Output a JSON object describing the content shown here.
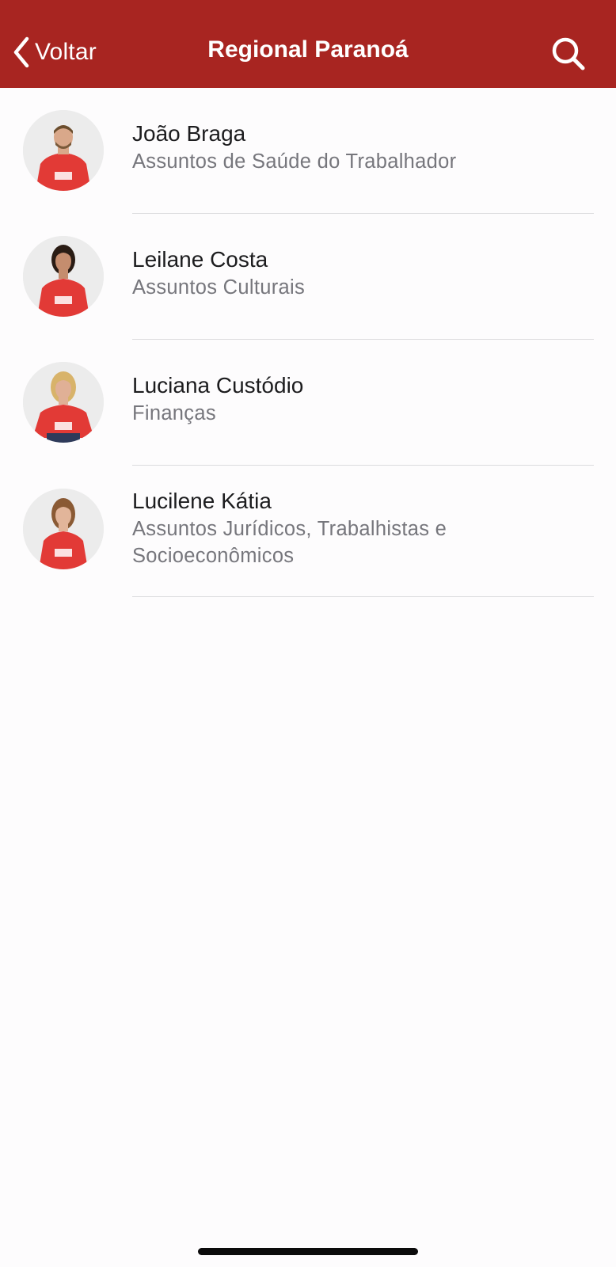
{
  "navbar": {
    "back_label": "Voltar",
    "title": "Regional Paranoá",
    "icons": {
      "back": "chevron-left-icon",
      "search": "search-icon"
    },
    "background_color": "#a82521"
  },
  "members": [
    {
      "name": "João Braga",
      "role": "Assuntos de Saúde do Trabalhador"
    },
    {
      "name": "Leilane Costa",
      "role": "Assuntos Culturais"
    },
    {
      "name": "Luciana Custódio",
      "role": "Finanças"
    },
    {
      "name": "Lucilene Kátia",
      "role": "Assuntos Jurídicos, Trabalhistas e Socioeconômicos"
    }
  ],
  "colors": {
    "accent": "#a82521",
    "shirt": "#e23a36",
    "background": "#fdfcfd"
  }
}
